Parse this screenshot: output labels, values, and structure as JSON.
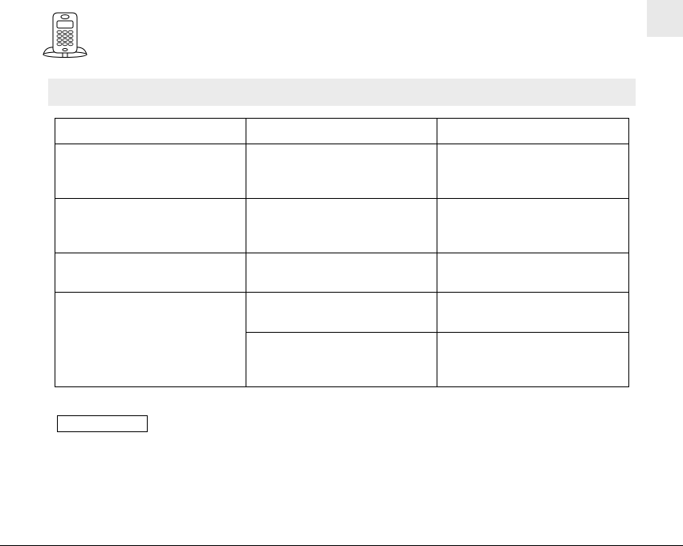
{
  "header": {
    "title": ""
  },
  "table": {
    "header": [
      "",
      "",
      ""
    ],
    "rows": [
      [
        "",
        "",
        ""
      ],
      [
        "",
        "",
        ""
      ],
      [
        "",
        "",
        ""
      ],
      [
        "",
        "",
        ""
      ],
      [
        "",
        ""
      ]
    ]
  },
  "note_label": "",
  "icons": {
    "phone": "cordless-phone-in-base-illustration"
  }
}
